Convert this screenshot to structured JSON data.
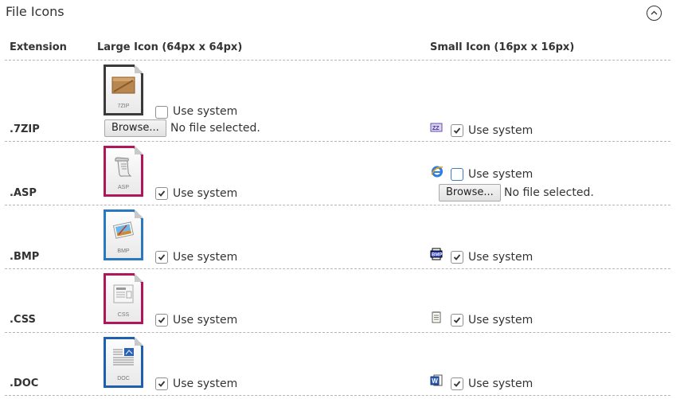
{
  "section": {
    "title": "File Icons",
    "collapse_icon": "chevron-up-circle-icon"
  },
  "columns": {
    "extension": "Extension",
    "large": "Large Icon (64px x 64px)",
    "small": "Small Icon (16px x 16px)"
  },
  "rows": [
    {
      "ext": ".7ZIP",
      "large": {
        "icon": "7zip-archive-icon",
        "caption": "7ZIP",
        "use_system": false,
        "use_system_label": "Use system",
        "browse_label": "Browse...",
        "file_status": "No file selected."
      },
      "small": {
        "icon": "7zip-small-icon",
        "use_system": true,
        "use_system_label": "Use system"
      }
    },
    {
      "ext": ".ASP",
      "large": {
        "icon": "asp-script-icon",
        "caption": "ASP",
        "use_system": true,
        "use_system_label": "Use system"
      },
      "small": {
        "icon": "internet-explorer-icon",
        "use_system": false,
        "use_system_label": "Use system",
        "browse_label": "Browse...",
        "file_status": "No file selected."
      }
    },
    {
      "ext": ".BMP",
      "large": {
        "icon": "bmp-image-icon",
        "caption": "BMP",
        "use_system": true,
        "use_system_label": "Use system"
      },
      "small": {
        "icon": "bmp-small-icon",
        "use_system": true,
        "use_system_label": "Use system"
      }
    },
    {
      "ext": ".CSS",
      "large": {
        "icon": "css-document-icon",
        "caption": "CSS",
        "use_system": true,
        "use_system_label": "Use system"
      },
      "small": {
        "icon": "notepad-icon",
        "use_system": true,
        "use_system_label": "Use system"
      }
    },
    {
      "ext": ".DOC",
      "large": {
        "icon": "doc-word-icon",
        "caption": "DOC",
        "use_system": true,
        "use_system_label": "Use system"
      },
      "small": {
        "icon": "word-small-icon",
        "use_system": true,
        "use_system_label": "Use system"
      }
    }
  ],
  "colors": {
    "text": "#333333",
    "rule": "#b5b5b5",
    "zip_frame": "#3a3a3a",
    "asp_frame": "#b0165a",
    "bmp_frame": "#2a78c0",
    "css_frame": "#b0165a",
    "doc_frame": "#1f5fae",
    "checkbox_focus": "#3a7bc8"
  }
}
